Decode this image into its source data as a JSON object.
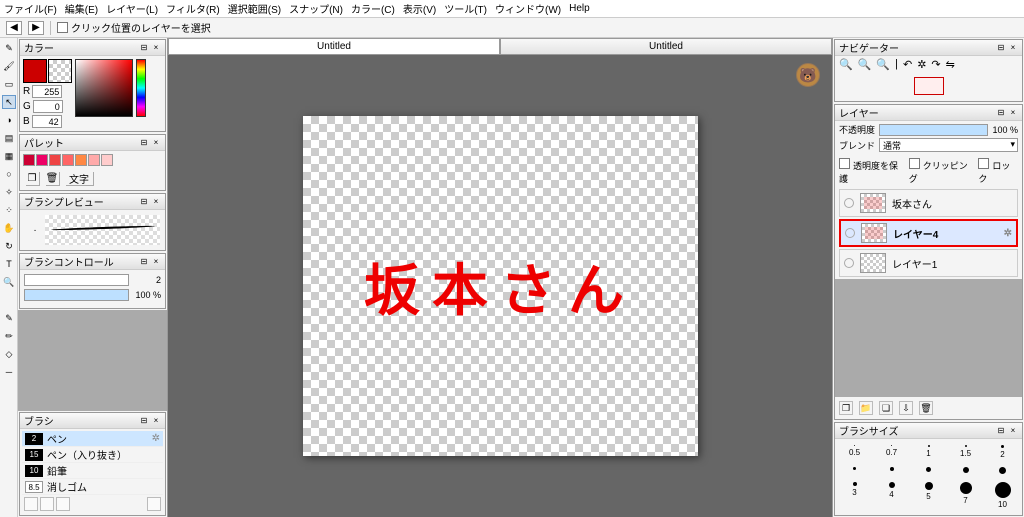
{
  "menu": {
    "file": "ファイル(F)",
    "edit": "編集(E)",
    "layer": "レイヤー(L)",
    "filter": "フィルタ(R)",
    "select": "選択範囲(S)",
    "snap": "スナップ(N)",
    "color": "カラー(C)",
    "view": "表示(V)",
    "tool": "ツール(T)",
    "window": "ウィンドウ(W)",
    "help": "Help"
  },
  "toolbar": {
    "click_layer_select": "クリック位置のレイヤーを選択"
  },
  "tabs": [
    "Untitled",
    "Untitled"
  ],
  "panels": {
    "color": {
      "title": "カラー",
      "r_label": "R",
      "g_label": "G",
      "b_label": "B",
      "r": "255",
      "g": "0",
      "b": "42"
    },
    "palette": {
      "title": "パレット",
      "moji": "文字"
    },
    "brush_preview": {
      "title": "ブラシプレビュー"
    },
    "brush_control": {
      "title": "ブラシコントロール",
      "size": "2",
      "opacity": "100 %"
    },
    "brush": {
      "title": "ブラシ",
      "items": [
        {
          "n": "2",
          "name": "ペン"
        },
        {
          "n": "15",
          "name": "ペン（入り抜き）"
        },
        {
          "n": "10",
          "name": "鉛筆"
        },
        {
          "n": "8.5",
          "name": "消しゴム"
        }
      ]
    },
    "navigator": {
      "title": "ナビゲーター"
    },
    "layer": {
      "title": "レイヤー",
      "opacity_label": "不透明度",
      "opacity": "100 %",
      "blend_label": "ブレンド",
      "blend_mode": "通常",
      "protect": "透明度を保護",
      "clipping": "クリッピング",
      "lock": "ロック",
      "items": [
        {
          "name": "坂本さん"
        },
        {
          "name": "レイヤー4",
          "selected": true
        },
        {
          "name": "レイヤー1"
        }
      ]
    },
    "brush_size": {
      "title": "ブラシサイズ",
      "sizes": [
        "0.5",
        "0.7",
        "1",
        "1.5",
        "2",
        "",
        "",
        "",
        "",
        "",
        "3",
        "4",
        "5",
        "7",
        "10"
      ]
    }
  },
  "canvas_text": "坂本さん",
  "avatar_emoji": "🐻"
}
